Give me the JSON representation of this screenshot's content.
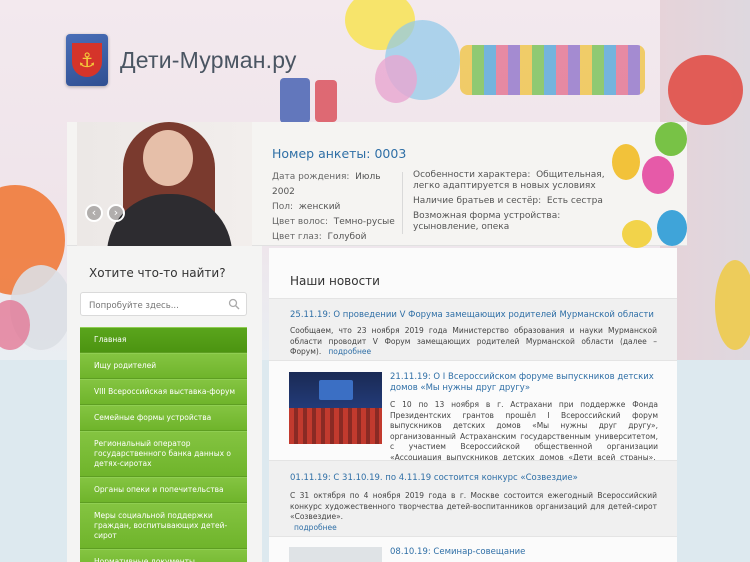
{
  "site": {
    "title": "Дети-Мурман.ру"
  },
  "profile": {
    "title": "Номер анкеты: 0003",
    "left": [
      {
        "key": "Дата рождения:",
        "value": "Июль 2002"
      },
      {
        "key": "Пол:",
        "value": "женский"
      },
      {
        "key": "Цвет волос:",
        "value": "Темно-русые"
      },
      {
        "key": "Цвет глаз:",
        "value": "Голубой"
      }
    ],
    "right": [
      {
        "key": "Особенности характера:",
        "value": "Общительная, легко адаптируется в новых условиях"
      },
      {
        "key": "Наличие братьев и сестёр:",
        "value": "Есть сестра"
      },
      {
        "key": "Возможная форма устройства:",
        "value": "усыновление, опека"
      }
    ],
    "prev_glyph": "‹",
    "next_glyph": "›"
  },
  "search": {
    "title": "Хотите что-то найти?",
    "placeholder": "Попробуйте здесь..."
  },
  "menu": {
    "items": [
      "Главная",
      "Ищу родителей",
      "VIII Всероссийская выставка-форум",
      "Семейные формы устройства",
      "Региональный оператор государственного банка данных о детях-сиротах",
      "Органы опеки и попечительства",
      "Меры социальной поддержки граждан, воспитывающих детей-сирот",
      "Нормативные документы"
    ]
  },
  "news": {
    "title": "Наши новости",
    "more_label": "подробнее",
    "items": [
      {
        "link": "25.11.19: О проведении V Форума замещающих родителей Мурманской области",
        "text": "Сообщаем, что 23 ноября 2019 года Министерство образования и науки Мурманской области проводит V Форум замещающих родителей Мурманской области (далее – Форум)."
      },
      {
        "link": "21.11.19: О I Всероссийском форуме выпускников детских домов «Мы нужны друг другу»",
        "text": "С 10 по 13 ноября в г. Астрахани при поддержке Фонда Президентских грантов прошёл I Всероссийский форум выпускников детских домов «Мы нужны друг другу», организованный Астраханским государственным университетом, с участием Всероссийской общественной организации «Ассоциация выпускников детских домов «Дети всей страны»."
      },
      {
        "link": "01.11.19: С 31.10.19. по 4.11.19 состоится конкурс «Созвездие»",
        "text": "С 31 октября по 4 ноября 2019 года в г. Москве состоится ежегодный Всероссийский конкурс художественного творчества детей-воспитанников организаций для детей-сирот «Созвездие»."
      },
      {
        "link": "08.10.19: Семинар-совещание",
        "text": ""
      }
    ]
  },
  "colors": {
    "accent_green": "#6fb42b",
    "active_green": "#4c9411",
    "link_blue": "#2f6fa6"
  },
  "icons": {
    "crest": "coat-of-arms-icon",
    "search": "search-icon",
    "prev": "chevron-left-icon",
    "next": "chevron-right-icon"
  }
}
